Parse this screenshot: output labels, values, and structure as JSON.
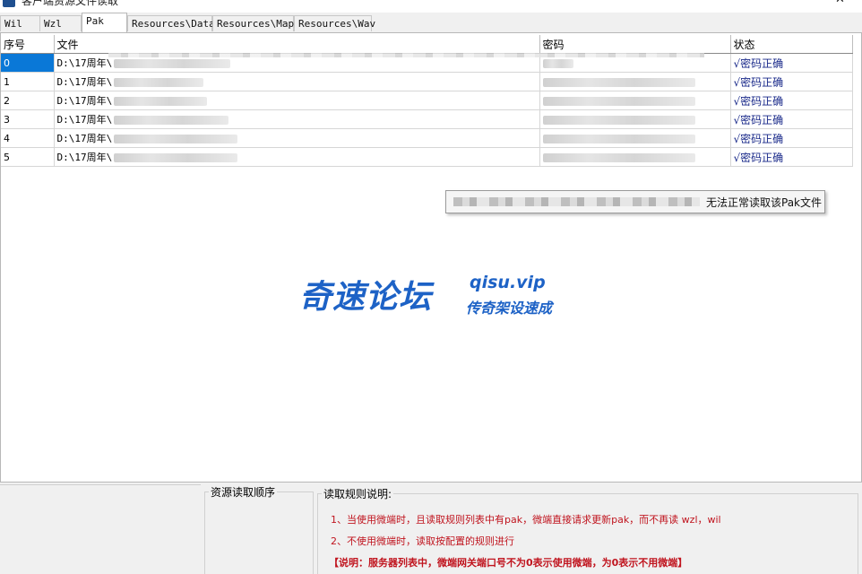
{
  "window": {
    "title": "客户端资源文件读取"
  },
  "tabs": [
    {
      "label": "Wil",
      "active": false
    },
    {
      "label": "Wzl",
      "active": false
    },
    {
      "label": "Pak",
      "active": true
    },
    {
      "label": "Resources\\Data",
      "active": false
    },
    {
      "label": "Resources\\Map",
      "active": false
    },
    {
      "label": "Resources\\Wav",
      "active": false
    }
  ],
  "grid": {
    "headers": {
      "index": "序号",
      "file": "文件",
      "password": "密码",
      "status": "状态"
    },
    "rows": [
      {
        "index": "0",
        "file": "D:\\17周年\\",
        "status": "√密码正确",
        "selected": true
      },
      {
        "index": "1",
        "file": "D:\\17周年\\",
        "status": "√密码正确"
      },
      {
        "index": "2",
        "file": "D:\\17周年\\",
        "status": "√密码正确"
      },
      {
        "index": "3",
        "file": "D:\\17周年\\",
        "status": "√密码正确"
      },
      {
        "index": "4",
        "file": "D:\\17周年\\",
        "status": "√密码正确"
      },
      {
        "index": "5",
        "file": "D:\\17周年\\",
        "status": "√密码正确"
      }
    ]
  },
  "tooltip": {
    "text": "无法正常读取该Pak文件"
  },
  "watermark": {
    "title": "奇速论坛",
    "url": "qisu.vip",
    "subtitle": "传奇架设速成"
  },
  "bottom": {
    "order_title": "资源读取顺序",
    "rules_title": "读取规则说明:",
    "rule1": "1、当使用微端时，且读取规则列表中有pak，微端直接请求更新pak，而不再读 wzl，wil",
    "rule2": "2、不使用微端时，读取按配置的规则进行",
    "note": "【说明：服务器列表中，微端网关端口号不为0表示使用微端，为0表示不用微端】"
  },
  "colors": {
    "selection": "#0a78d7",
    "status_text": "#1a2a8a",
    "rule_text": "#c0141e",
    "watermark": "#1d62c6"
  }
}
